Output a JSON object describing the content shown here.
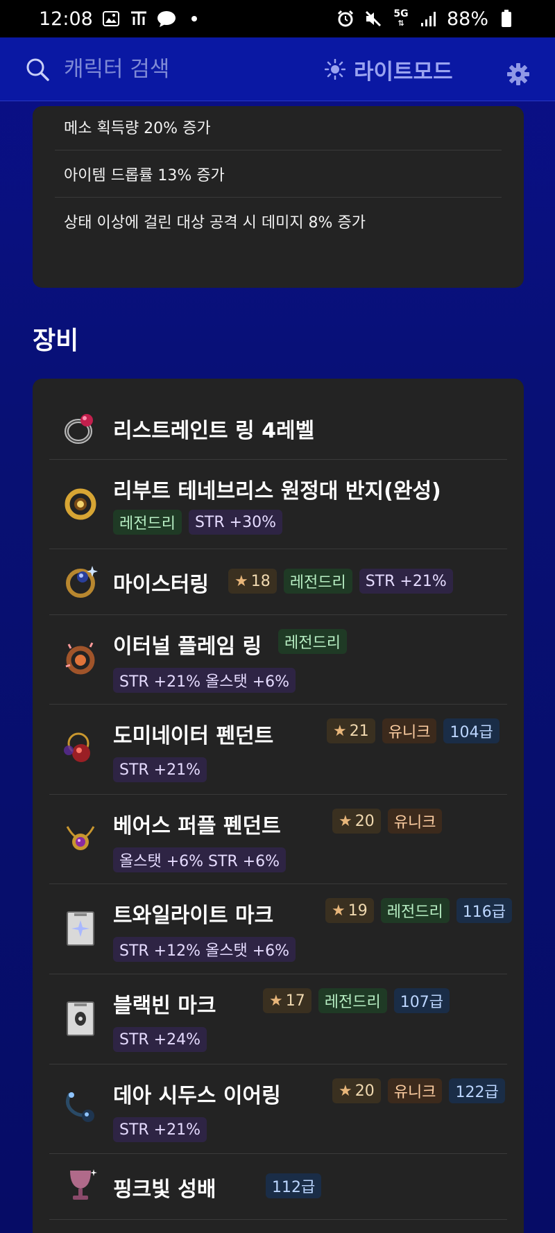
{
  "status_bar": {
    "time": "12:08",
    "battery": "88%",
    "network": "5G"
  },
  "app_bar": {
    "search_placeholder": "캐릭터 검색",
    "mode_label": "라이트모드"
  },
  "stats": [
    "메소 획득량 20% 증가",
    "아이템 드롭률 13% 증가",
    "상태 이상에 걸린 대상 공격 시 데미지 8% 증가"
  ],
  "equipment_section_title": "장비",
  "equipment": [
    {
      "name": "리스트레인트 링 4레벨",
      "icon": "ring-icon",
      "star": null,
      "grade": null,
      "level": null,
      "stats": null
    },
    {
      "name": "리부트 테네브리스 원정대 반지(완성)",
      "icon": "gold-ring-icon",
      "star": null,
      "grade": "레전드리",
      "level": null,
      "stats": "STR +30%"
    },
    {
      "name": "마이스터링",
      "icon": "meister-ring-icon",
      "star": "18",
      "grade": "레전드리",
      "level": null,
      "stats": "STR +21%"
    },
    {
      "name": "이터널 플레임 링",
      "icon": "flame-ring-icon",
      "star": null,
      "grade": "레전드리",
      "level": null,
      "stats": "STR +21% 올스탯 +6%"
    },
    {
      "name": "도미네이터 펜던트",
      "icon": "pendant-icon",
      "star": "21",
      "grade": "유니크",
      "level": "104급",
      "stats": "STR +21%"
    },
    {
      "name": "베어스 퍼플 펜던트",
      "icon": "purple-pendant-icon",
      "star": "20",
      "grade": "유니크",
      "level": null,
      "stats": "올스탯 +6% STR +6%"
    },
    {
      "name": "트와일라이트 마크",
      "icon": "mark-icon",
      "star": "19",
      "grade": "레전드리",
      "level": "116급",
      "stats": "STR +12% 올스탯 +6%"
    },
    {
      "name": "블랙빈 마크",
      "icon": "blackbean-mark-icon",
      "star": "17",
      "grade": "레전드리",
      "level": "107급",
      "stats": "STR +24%"
    },
    {
      "name": "데아 시두스 이어링",
      "icon": "earring-icon",
      "star": "20",
      "grade": "유니크",
      "level": "122급",
      "stats": "STR +21%"
    },
    {
      "name": "핑크빛 성배",
      "icon": "chalice-icon",
      "star": null,
      "grade": null,
      "level": "112급",
      "stats": null
    }
  ]
}
